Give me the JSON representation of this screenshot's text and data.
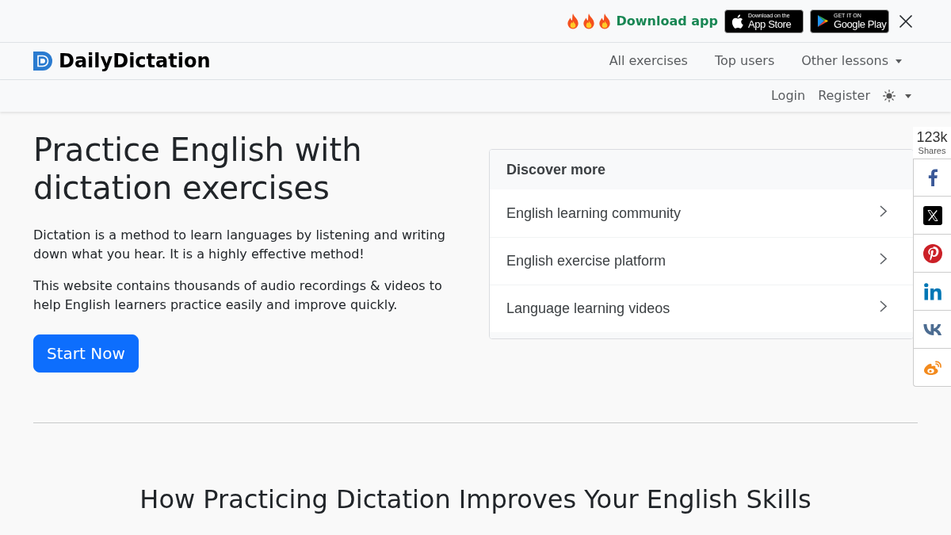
{
  "promo_bar": {
    "text": "Download app",
    "store_badges": [
      {
        "kind": "apple",
        "caption": "Download on the",
        "label": "App Store"
      },
      {
        "kind": "google",
        "caption": "GET IT ON",
        "label": "Google Play"
      }
    ]
  },
  "navbar": {
    "brand": "DailyDictation",
    "links": [
      {
        "label": "All exercises",
        "dropdown": false
      },
      {
        "label": "Top users",
        "dropdown": false
      },
      {
        "label": "Other lessons",
        "dropdown": true
      }
    ]
  },
  "account_bar": {
    "links": [
      "Login",
      "Register"
    ],
    "theme_toggle": {
      "dropdown": true
    }
  },
  "hero": {
    "title": "Practice English with dictation exercises",
    "paragraphs": [
      "Dictation is a method to learn languages by listening and writing down what you hear. It is a highly effective method!",
      "This website contains thousands of audio recordings & videos to help English learners practice easily and improve quickly."
    ],
    "button": "Start Now"
  },
  "discover_card": {
    "title": "Discover more",
    "items": [
      "English learning community",
      "English exercise platform",
      "Language learning videos"
    ]
  },
  "share_bar": {
    "count": "123k",
    "label": "Shares",
    "buttons": [
      {
        "kind": "facebook"
      },
      {
        "kind": "x"
      },
      {
        "kind": "pinterest"
      },
      {
        "kind": "linkedin"
      },
      {
        "kind": "vk"
      },
      {
        "kind": "weibo"
      }
    ]
  },
  "section": {
    "title": "How Practicing Dictation Improves Your English Skills"
  }
}
